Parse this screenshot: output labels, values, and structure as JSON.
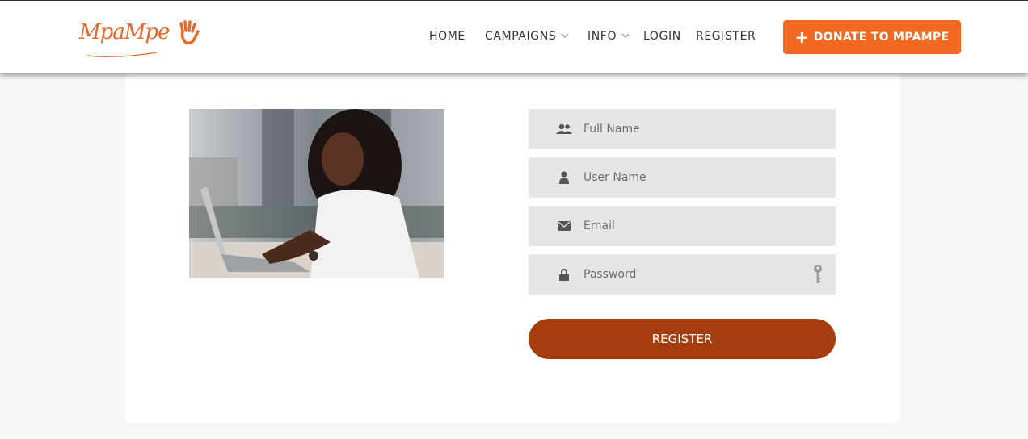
{
  "brand": {
    "logo_text": "MpaMpe",
    "accent": "#f26922",
    "button_dark": "#a63d0e"
  },
  "nav": {
    "items": [
      {
        "label": "HOME",
        "dropdown": false
      },
      {
        "label": "CAMPAIGNS",
        "dropdown": true
      },
      {
        "label": "INFO",
        "dropdown": true
      },
      {
        "label": "LOGIN",
        "dropdown": false
      },
      {
        "label": "REGISTER",
        "dropdown": false
      }
    ],
    "donate_label": "DONATE TO MPAMPE",
    "donate_icon": "plus-icon"
  },
  "form": {
    "full_name": {
      "placeholder": "Full Name",
      "icon": "users-icon"
    },
    "user_name": {
      "placeholder": "User Name",
      "icon": "user-icon"
    },
    "email": {
      "placeholder": "Email",
      "icon": "envelope-icon"
    },
    "password": {
      "placeholder": "Password",
      "icon": "lock-icon",
      "toggle_icon": "key-icon"
    },
    "submit_label": "REGISTER"
  },
  "hero_image": {
    "subject": "woman-typing-on-laptop"
  }
}
